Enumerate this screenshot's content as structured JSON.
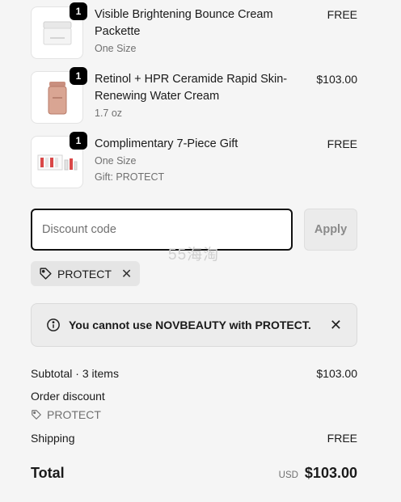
{
  "items": [
    {
      "qty": "1",
      "title": "Visible Brightening Bounce Cream Packette",
      "variant": "One Size",
      "price": "FREE",
      "icon": "cream-jar-icon"
    },
    {
      "qty": "1",
      "title": "Retinol + HPR Ceramide Rapid Skin-Renewing Water Cream",
      "variant": "1.7 oz",
      "price": "$103.00",
      "icon": "cream-jar-rose-icon"
    },
    {
      "qty": "1",
      "title": "Complimentary 7-Piece Gift",
      "variant": "One Size",
      "note": "Gift: PROTECT",
      "price": "FREE",
      "icon": "gift-set-icon"
    }
  ],
  "discount": {
    "placeholder": "Discount code",
    "apply_label": "Apply",
    "applied_code": "PROTECT"
  },
  "watermark": "55海淘",
  "alert": {
    "message": "You cannot use NOVBEAUTY with PROTECT."
  },
  "summary": {
    "subtotal_label": "Subtotal · 3 items",
    "subtotal_value": "$103.00",
    "order_discount_label": "Order discount",
    "order_discount_code": "PROTECT",
    "shipping_label": "Shipping",
    "shipping_value": "FREE",
    "total_label": "Total",
    "currency": "USD",
    "total_value": "$103.00"
  }
}
